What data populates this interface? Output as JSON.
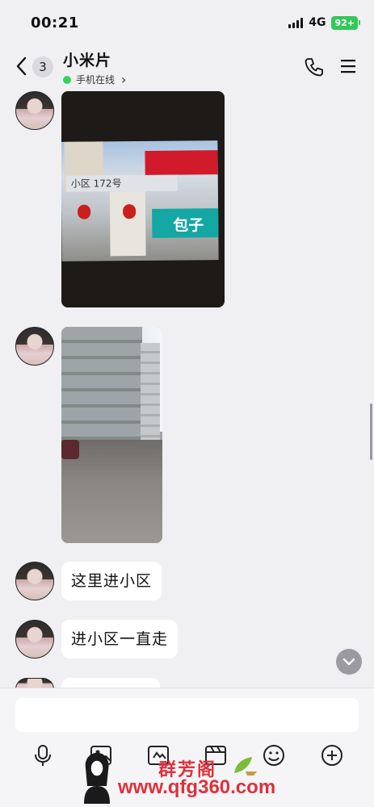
{
  "status_bar": {
    "time": "00:21",
    "network": "4G",
    "battery": "92+"
  },
  "header": {
    "unread_count": "3",
    "title": "小米片",
    "presence": "手机在线",
    "presence_chevron": "›"
  },
  "messages": [
    {
      "type": "image",
      "depicts": "street photo with building signs",
      "sign_text": "小区  172号",
      "shop_text": "包子"
    },
    {
      "type": "image",
      "depicts": "residential buildings and road"
    },
    {
      "type": "text",
      "text": "这里进小区"
    },
    {
      "type": "text",
      "text": "进小区一直走"
    }
  ],
  "input": {
    "value": "",
    "placeholder": ""
  },
  "toolbar": [
    "voice-icon",
    "image-icon",
    "camera-icon",
    "video-icon",
    "emoji-icon",
    "more-icon"
  ],
  "watermark": {
    "title": "群芳阁",
    "url": "www.qfg360.com"
  },
  "colors": {
    "online": "#3ad15a",
    "battery": "#34c759",
    "watermark": "#e0303c"
  }
}
